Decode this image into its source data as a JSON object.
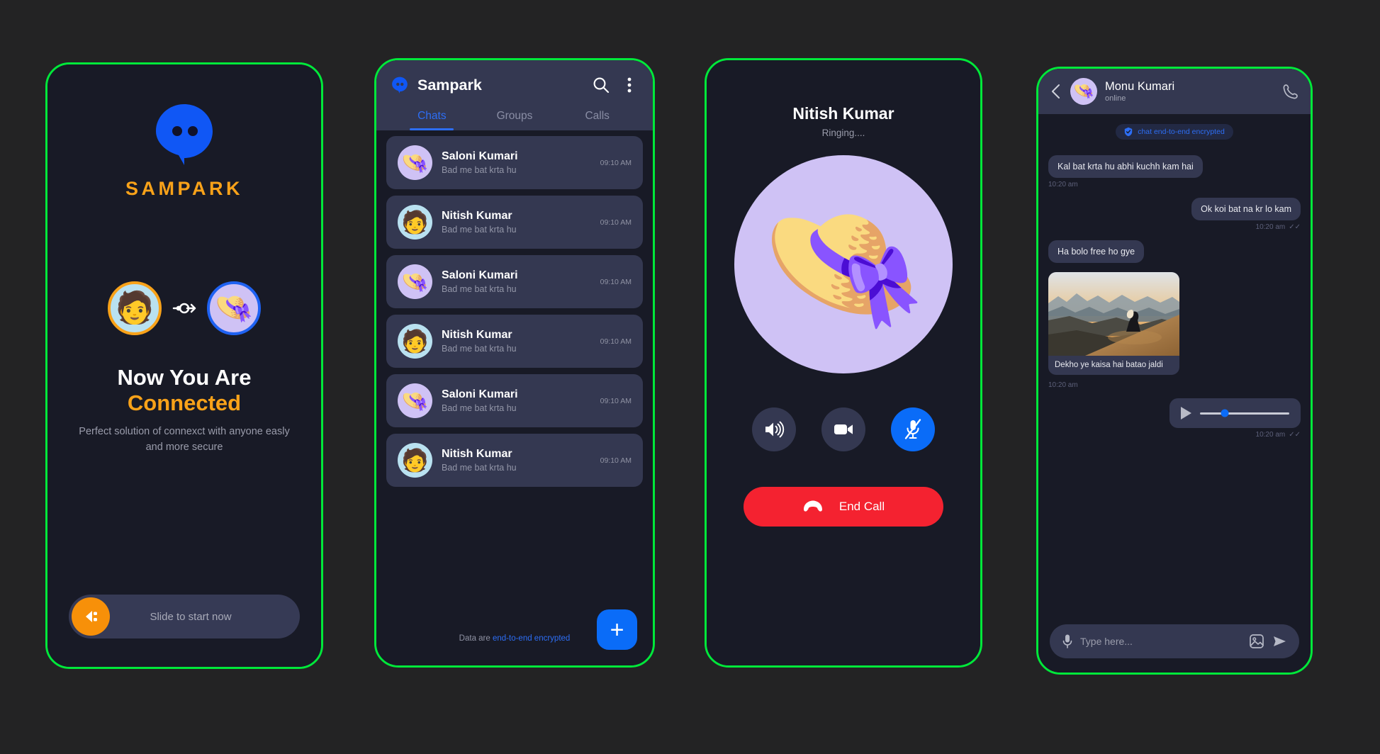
{
  "brand": {
    "name": "SAMPARK",
    "title_case": "Sampark",
    "logo_icon": "chat-blob-icon",
    "accent_orange": "#f8a219",
    "accent_blue": "#0a6cf8",
    "frame_green": "#00e83a",
    "bg_dark": "#181a26",
    "surface": "#343851"
  },
  "screen1": {
    "logo_icon": "chat-blob-icon",
    "brand_name": "SAMPARK",
    "avatar_left_icon": "memoji-male-avatar",
    "avatar_right_icon": "memoji-female-hat-avatar",
    "connector_icon": "link-arrow-icon",
    "headline_line1": "Now You Are",
    "headline_line2": "Connected",
    "subtext": "Perfect solution of connexct with anyone easly and more secure",
    "slide_label": "Slide to start now",
    "slide_knob_icon": "plug-left-icon"
  },
  "screen2": {
    "logo_icon": "chat-blob-icon",
    "title": "Sampark",
    "search_icon": "search-icon",
    "menu_icon": "three-dot-menu-icon",
    "tabs": [
      {
        "label": "Chats",
        "active": true
      },
      {
        "label": "Groups",
        "active": false
      },
      {
        "label": "Calls",
        "active": false
      }
    ],
    "chats": [
      {
        "name": "Saloni Kumari",
        "snippet": "Bad me bat krta hu",
        "time": "09:10 AM",
        "avatar": "memoji-female-hat-avatar"
      },
      {
        "name": "Nitish Kumar",
        "snippet": "Bad me bat krta hu",
        "time": "09:10 AM",
        "avatar": "memoji-male-avatar"
      },
      {
        "name": "Saloni Kumari",
        "snippet": "Bad me bat krta hu",
        "time": "09:10 AM",
        "avatar": "memoji-female-hat-avatar"
      },
      {
        "name": "Nitish Kumar",
        "snippet": "Bad me bat krta hu",
        "time": "09:10 AM",
        "avatar": "memoji-male-avatar"
      },
      {
        "name": "Saloni Kumari",
        "snippet": "Bad me bat krta hu",
        "time": "09:10 AM",
        "avatar": "memoji-female-hat-avatar"
      },
      {
        "name": "Nitish Kumar",
        "snippet": "Bad me bat krta hu",
        "time": "09:10 AM",
        "avatar": "memoji-male-avatar"
      }
    ],
    "footer_note_prefix": "Data are ",
    "footer_note_link": "end-to-end encrypted",
    "fab_label": "+",
    "fab_icon": "plus-icon"
  },
  "screen3": {
    "caller_name": "Nitish Kumar",
    "call_status": "Ringing....",
    "avatar_icon": "memoji-female-hat-avatar",
    "controls": [
      {
        "name": "speaker",
        "icon": "speaker-icon",
        "active": false
      },
      {
        "name": "video",
        "icon": "video-camera-icon",
        "active": false
      },
      {
        "name": "mute",
        "icon": "microphone-muted-icon",
        "active": true
      }
    ],
    "end_call_label": "End Call",
    "end_call_icon": "phone-hangup-icon"
  },
  "screen4": {
    "back_icon": "chevron-left-icon",
    "contact_name": "Monu Kumari",
    "contact_status": "online",
    "contact_avatar": "memoji-female-hat-avatar",
    "call_icon": "phone-icon",
    "encryption_badge": "chat end-to-end encrypted",
    "encryption_icon": "shield-lock-icon",
    "messages": [
      {
        "type": "text",
        "side": "left",
        "text": "Kal bat krta hu abhi kuchh kam hai",
        "time": "10:20 am",
        "ticks": false
      },
      {
        "type": "text",
        "side": "right",
        "text": "Ok koi bat na kr lo kam",
        "time": "10:20 am",
        "ticks": true
      },
      {
        "type": "text",
        "side": "left",
        "text": "Ha bolo free ho gye",
        "time": "",
        "ticks": false
      },
      {
        "type": "image",
        "side": "left",
        "caption": "Dekho ye kaisa hai batao jaldi",
        "time": "10:20 am",
        "ticks": false,
        "image_alt": "desert-mountain-sunset-photo"
      },
      {
        "type": "voice",
        "side": "right",
        "progress_percent": 28,
        "time": "10:20 am",
        "ticks": true,
        "play_icon": "play-icon"
      }
    ],
    "input_placeholder": "Type here...",
    "mic_icon": "microphone-icon",
    "gallery_icon": "image-icon",
    "send_icon": "send-icon"
  }
}
